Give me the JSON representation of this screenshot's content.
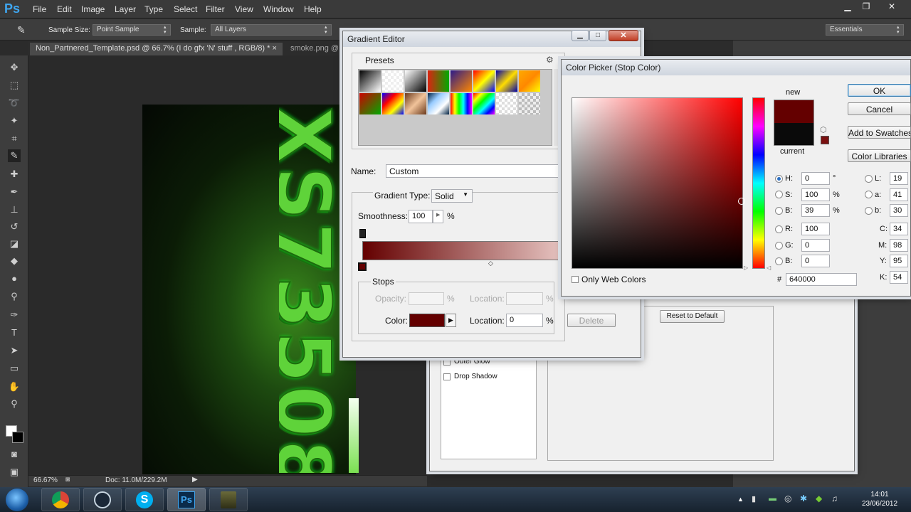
{
  "app": {
    "logo": "Ps"
  },
  "menu": [
    "File",
    "Edit",
    "Image",
    "Layer",
    "Type",
    "Select",
    "Filter",
    "View",
    "Window",
    "Help"
  ],
  "options_bar": {
    "sample_size_label": "Sample Size:",
    "sample_size_value": "Point Sample",
    "sample_label": "Sample:",
    "sample_value": "All Layers",
    "workspace": "Essentials"
  },
  "tabs": [
    {
      "label": "Non_Partnered_Template.psd @ 66.7% (I do gfx 'N' stuff , RGB/8) *",
      "close": "×"
    },
    {
      "label": "smoke.png @",
      "close": ""
    }
  ],
  "canvas": {
    "art_text": "XS73508"
  },
  "status": {
    "zoom": "66.67%",
    "doc": "Doc: 11.0M/229.2M"
  },
  "gradient_editor": {
    "title": "Gradient Editor",
    "presets_label": "Presets",
    "name_label": "Name:",
    "name_value": "Custom",
    "gradient_type_label": "Gradient Type:",
    "gradient_type_value": "Solid",
    "smoothness_label": "Smoothness:",
    "smoothness_value": "100",
    "smoothness_unit": "%",
    "stops_label": "Stops",
    "opacity_label": "Opacity:",
    "opacity_unit": "%",
    "location_label": "Location:",
    "location_unit": "%",
    "delete_label": "Delete",
    "color_label": "Color:",
    "color_location_value": "0",
    "stop_color": "#640000"
  },
  "color_picker": {
    "title": "Color Picker (Stop Color)",
    "ok": "OK",
    "cancel": "Cancel",
    "add_to_swatches": "Add to Swatches",
    "color_libraries": "Color Libraries",
    "new_label": "new",
    "current_label": "current",
    "only_web_colors": "Only Web Colors",
    "hsb": [
      {
        "label": "H:",
        "value": "0",
        "unit": "°"
      },
      {
        "label": "S:",
        "value": "100",
        "unit": "%"
      },
      {
        "label": "B:",
        "value": "39",
        "unit": "%"
      }
    ],
    "rgb": [
      {
        "label": "R:",
        "value": "100"
      },
      {
        "label": "G:",
        "value": "0"
      },
      {
        "label": "B:",
        "value": "0"
      }
    ],
    "lab": [
      {
        "label": "L:",
        "value": "19"
      },
      {
        "label": "a:",
        "value": "41"
      },
      {
        "label": "b:",
        "value": "30"
      }
    ],
    "cmyk": [
      {
        "label": "C:",
        "value": "34"
      },
      {
        "label": "M:",
        "value": "98"
      },
      {
        "label": "Y:",
        "value": "95"
      },
      {
        "label": "K:",
        "value": "54"
      }
    ],
    "hex_label": "#",
    "hex_value": "640000",
    "new_color": "#640000",
    "current_color": "#0a0a0a"
  },
  "layer_style": {
    "reset_label": "Reset to Default",
    "items": [
      "Outer Glow",
      "Drop Shadow"
    ]
  },
  "taskbar": {
    "time": "14:01",
    "date": "23/06/2012"
  }
}
